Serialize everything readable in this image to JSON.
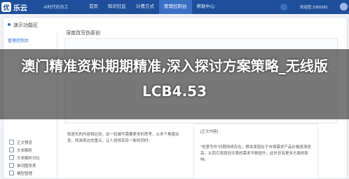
{
  "header": {
    "logo_mark": "优",
    "logo_text": "乐云",
    "slogan": "AI时代的员工",
    "nav": [
      "首页",
      "知识社区",
      "计费方式",
      "管理控制台",
      "帮助中心"
    ],
    "active_nav": "管理控制台",
    "user": "欢迎您 2365382"
  },
  "page": {
    "panel_title": "演示功能区",
    "sidebar_top": "管理控制台",
    "sidebar_items": [
      "正文预览",
      "文本解析",
      "文本解析对比",
      "单词图发表",
      "模型管理"
    ],
    "doc_title": "深度改写伪原创",
    "left_text": "和原先的内容相比较，这一轮编写需要更多的思考，从多个角度出发，找准表达的重点，让人觉得耳目一新的同时。",
    "right_head": "[正文内容]",
    "right_text": "\"创意写作\"问题持续存在，根本原因在于市场需求产品价格逐渐提高，从而引发原创文章的需求不断提升，此外还有更多方面的影响。"
  },
  "headline": "澳门精准资料期期精准,深入探讨方案策略_无线版LCB4.53"
}
